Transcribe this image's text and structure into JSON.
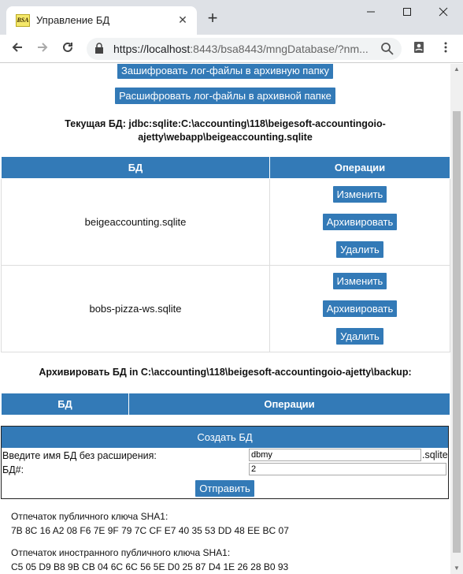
{
  "browser": {
    "tab_title": "Управление БД",
    "favicon_text": "BSA",
    "url_host": "https://localhost",
    "url_rest": ":8443/bsa8443/mngDatabase/?nm...",
    "new_tab": "+",
    "close": "✕",
    "minimize": "—",
    "maximize": "☐",
    "win_close": "✕"
  },
  "actions": {
    "encrypt_logs": "Зашифровать лог-файлы в архивную папку",
    "decrypt_logs": "Расшифровать лог-файлы в архивной папке"
  },
  "current_db": {
    "text": "Текущая БД: jdbc:sqlite:C:\\accounting\\118\\beigesoft-accountingoio-ajetty\\webapp\\beigeaccounting.sqlite"
  },
  "db_table": {
    "headers": [
      "БД",
      "Операции"
    ],
    "rows": [
      {
        "name": "beigeaccounting.sqlite",
        "ops": [
          "Изменить",
          "Архивировать",
          "Удалить"
        ]
      },
      {
        "name": "bobs-pizza-ws.sqlite",
        "ops": [
          "Изменить",
          "Архивировать",
          "Удалить"
        ]
      }
    ]
  },
  "archive": {
    "title": "Архивировать БД in C:\\accounting\\118\\beigesoft-accountingoio-ajetty\\backup:",
    "headers": [
      "БД",
      "Операции"
    ]
  },
  "create_form": {
    "title": "Создать БД",
    "name_label": "Введите имя БД без расширения:",
    "name_value": "dbmy",
    "extension": ".sqlite",
    "id_label": "БД#:",
    "id_value": "2",
    "submit": "Отправить"
  },
  "fingerprints": {
    "public_label": "Отпечаток публичного ключа SHA1:",
    "public_value": "7B 8C 16 A2 08 F6 7E 9F 79 7C CF E7 40 35 53 DD 48 EE BC 07",
    "foreign_label": "Отпечаток иностранного публичного ключа SHA1:",
    "foreign_value": "C5 05 D9 B8 9B CB 04 6C 6C 56 5E D0 25 87 D4 1E 26 28 B0 93"
  },
  "colors": {
    "primary": "#337ab7",
    "tabstrip": "#dee1e6"
  }
}
